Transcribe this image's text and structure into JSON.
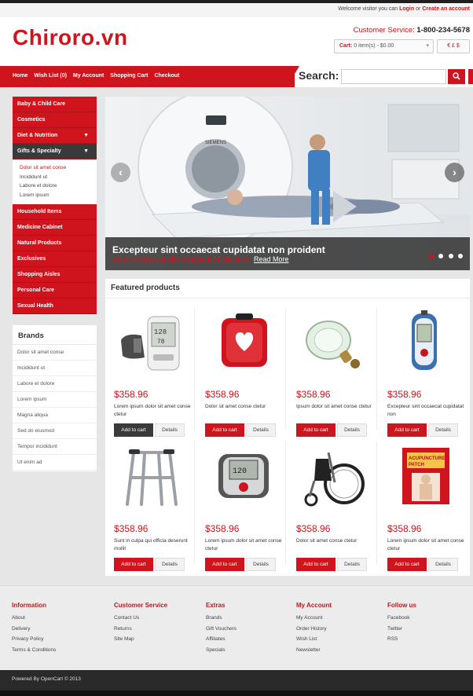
{
  "topbar": {
    "welcome": "Welcome visitor you can",
    "login": "Login",
    "or": "or",
    "create_account": "Create an account"
  },
  "header": {
    "logo": "Chiroro.vn",
    "customer_service_label": "Customer Service:",
    "phone": "1-800-234-5678",
    "cart_label": "Cart:",
    "cart_value": "0 item(s) - $0.00",
    "currencies": "€ £ $"
  },
  "nav": {
    "items": [
      "Home",
      "Wish List (0)",
      "My Account",
      "Shopping Cart",
      "Checkout"
    ],
    "search_label": "Search:"
  },
  "sidebar": {
    "categories_top": [
      "Baby & Child Care",
      "Cosmetics",
      "Diet & Nutrition",
      "Gifts & Specialty"
    ],
    "subcategories": [
      "Dolor sit amet conse",
      "Incididunt ut",
      "Labore et dolore",
      "Lorem ipsum"
    ],
    "categories_bottom": [
      "Household Items",
      "Medicine Cabinet",
      "Natural Products",
      "Exclusives",
      "Shopping Aisles",
      "Personal Care",
      "Sexual Health"
    ]
  },
  "brands": {
    "title": "Brands",
    "items": [
      "Dolor sit amet conse",
      "Incididunt ut",
      "Labore et dolore",
      "Lorem ipsum",
      "Magna aliqua",
      "Sed do eiusmod",
      "Tempor incididunt",
      "Ut enim ad"
    ]
  },
  "slider": {
    "caption_title": "Excepteur sint occaecat cupidatat non proident",
    "caption_sub": "Sunt in culpa qui officia deserunt mollit anim",
    "read_more": "Read More",
    "brand_on_machine": "SIEMENS"
  },
  "featured": {
    "title": "Featured products",
    "add_to_cart": "Add to cart",
    "details": "Details",
    "products": [
      {
        "price": "$358.96",
        "name": "Lorem ipsum dolor sit amet conse ctetur",
        "icon": "blood-pressure-monitor-icon"
      },
      {
        "price": "$358.96",
        "name": "Dolor sit amet conse ctetur",
        "icon": "defibrillator-case-icon"
      },
      {
        "price": "$358.96",
        "name": "Ipsum dolor sit amet conse ctetur",
        "icon": "oxygen-mask-icon"
      },
      {
        "price": "$358.96",
        "name": "Excepteur sint occaecat cupidatat non",
        "icon": "glucose-meter-icon"
      },
      {
        "price": "$358.96",
        "name": "Sunt in culpa qui officia deserunt mollit",
        "icon": "walker-icon"
      },
      {
        "price": "$358.96",
        "name": "Lorem ipsum dolor sit amet conse ctetur",
        "icon": "wrist-monitor-icon"
      },
      {
        "price": "$358.96",
        "name": "Dolor sit amet conse ctetur",
        "icon": "wheelchair-icon"
      },
      {
        "price": "$358.96",
        "name": "Lorem ipsum dolor sit amet conse ctetur",
        "icon": "acupuncture-patch-icon"
      }
    ],
    "patch_label_1": "ACUPUNCTURE",
    "patch_label_2": "PATCH"
  },
  "footer": {
    "columns": [
      {
        "title": "Information",
        "links": [
          "About",
          "Delivery",
          "Privacy Policy",
          "Terms & Conditions"
        ]
      },
      {
        "title": "Customer Service",
        "links": [
          "Contact Us",
          "Returns",
          "Site Map"
        ]
      },
      {
        "title": "Extras",
        "links": [
          "Brands",
          "Gift Vouchers",
          "Affiliates",
          "Specials"
        ]
      },
      {
        "title": "My Account",
        "links": [
          "My Account",
          "Order History",
          "Wish List",
          "Newsletter"
        ]
      },
      {
        "title": "Follow us",
        "links": [
          "Facebook",
          "Twitter",
          "RSS"
        ]
      }
    ],
    "powered": "Powered By OpenCart © 2013"
  },
  "colors": {
    "brand_red": "#d0141d",
    "dark": "#3a3a3a"
  }
}
